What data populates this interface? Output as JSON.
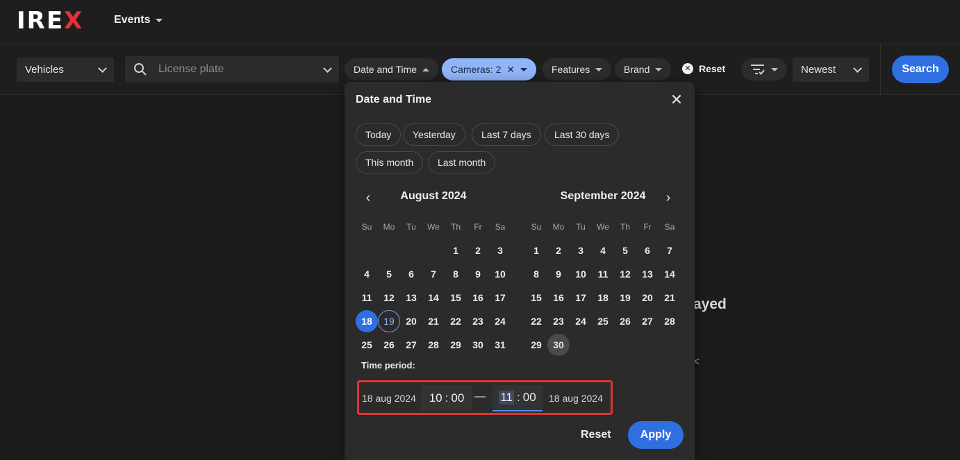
{
  "brand": {
    "logo": "IREX",
    "accent": "#e8303a"
  },
  "nav": {
    "section": "Events"
  },
  "filters": {
    "type_select": "Vehicles",
    "plate_placeholder": "License plate",
    "date_time": "Date and Time",
    "cameras": "Cameras: 2",
    "features": "Features",
    "brand": "Brand",
    "reset": "Reset",
    "sort": "Newest",
    "search": "Search"
  },
  "background": {
    "fragment": "ayed",
    "fragment2": "<"
  },
  "popup": {
    "title": "Date and Time",
    "presets": [
      "Today",
      "Yesterday",
      "Last 7 days",
      "Last 30 days",
      "This month",
      "Last month"
    ],
    "left_month": "August 2024",
    "right_month": "September 2024",
    "weekdays": [
      "Su",
      "Mo",
      "Tu",
      "We",
      "Th",
      "Fr",
      "Sa"
    ],
    "august_weeks": [
      [
        "",
        "",
        "",
        "",
        "1",
        "2",
        "3"
      ],
      [
        "4",
        "5",
        "6",
        "7",
        "8",
        "9",
        "10"
      ],
      [
        "11",
        "12",
        "13",
        "14",
        "15",
        "16",
        "17"
      ],
      [
        "18",
        "19",
        "20",
        "21",
        "22",
        "23",
        "24"
      ],
      [
        "25",
        "26",
        "27",
        "28",
        "29",
        "30",
        "31"
      ]
    ],
    "september_weeks": [
      [
        "1",
        "2",
        "3",
        "4",
        "5",
        "6",
        "7"
      ],
      [
        "8",
        "9",
        "10",
        "11",
        "12",
        "13",
        "14"
      ],
      [
        "15",
        "16",
        "17",
        "18",
        "19",
        "20",
        "21"
      ],
      [
        "22",
        "23",
        "24",
        "25",
        "26",
        "27",
        "28"
      ],
      [
        "29",
        "30",
        "",
        "",
        "",
        "",
        ""
      ]
    ],
    "selected_day": "18",
    "today_ring_day": "19",
    "muted_day": "30",
    "time_period_label": "Time period:",
    "start_date": "18 aug 2024",
    "start_hour": "10",
    "start_min": "00",
    "dash": "—",
    "end_hour": "11",
    "end_min": "00",
    "end_date": "18 aug 2024",
    "reset": "Reset",
    "apply": "Apply"
  },
  "colors": {
    "primary": "#2f6fe0",
    "chip_active": "#8fb4f7",
    "highlight_border": "#e03434"
  }
}
